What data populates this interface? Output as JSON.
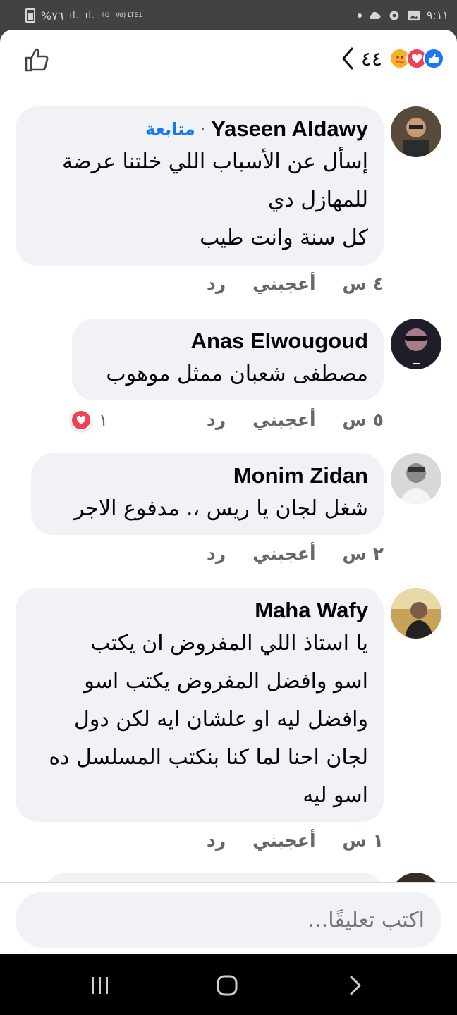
{
  "status_bar": {
    "battery_text": "%٧٦",
    "network_type": "4G",
    "network_sub": "Vo) LTE1",
    "time": "٩:١١"
  },
  "header": {
    "reaction_count": "٤٤",
    "reactions": [
      "care-icon",
      "love-icon",
      "like-icon"
    ]
  },
  "comments": [
    {
      "author": "Yaseen Aldawy",
      "follow_label": "متابعة",
      "lines": [
        "إسأل عن الأسباب اللي خلتنا عرضة",
        "للمهازل دي",
        "كل سنة وانت طيب"
      ],
      "time": "٤ س",
      "like_label": "أعجبني",
      "reply_label": "رد"
    },
    {
      "author": "Anas Elwougoud",
      "lines": [
        "مصطفى شعبان ممثل موهوب"
      ],
      "time": "٥ س",
      "like_label": "أعجبني",
      "reply_label": "رد",
      "reaction_count": "١"
    },
    {
      "author": "Monim Zidan",
      "lines": [
        "شغل لجان يا ريس ،. مدفوع الاجر"
      ],
      "time": "٢ س",
      "like_label": "أعجبني",
      "reply_label": "رد"
    },
    {
      "author": "Maha Wafy",
      "lines": [
        "يا استاذ اللي المفروض ان يكتب",
        "اسو وافضل المفروض يكتب اسو",
        "وافضل ليه او علشان ايه لكن دول",
        "لجان احنا لما كنا بنكتب المسلسل ده",
        "اسو ليه"
      ],
      "time": "١ س",
      "like_label": "أعجبني",
      "reply_label": "رد"
    }
  ],
  "composer": {
    "placeholder": "اكتب تعليقًا..."
  },
  "colors": {
    "accent": "#1877f2",
    "bubble": "#f0f2f5",
    "love": "#f33e58",
    "care": "#f7b125"
  }
}
